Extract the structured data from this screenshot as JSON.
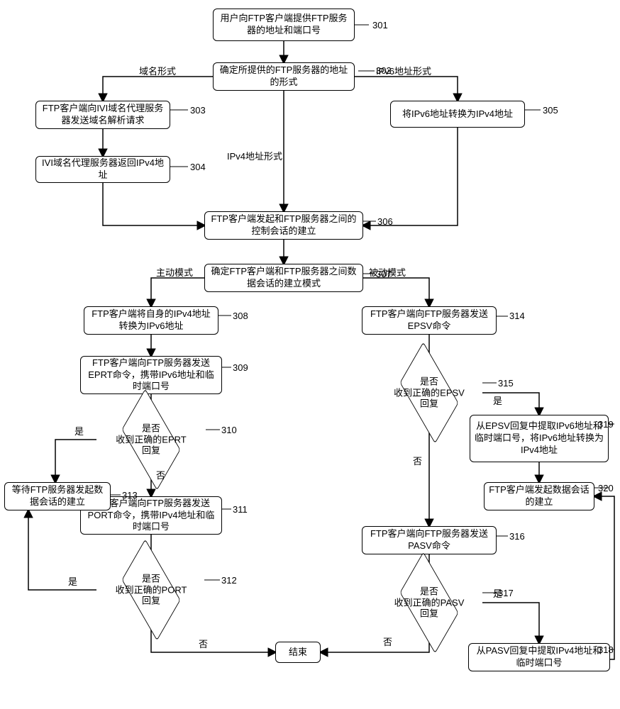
{
  "flowchart": {
    "n301": "用户向FTP客户端提供FTP服务器的地址和端口号",
    "n302": "确定所提供的FTP服务器的地址的形式",
    "n303": "FTP客户端向IVI域名代理服务器发送域名解析请求",
    "n304": "IVI域名代理服务器返回IPv4地址",
    "n305": "将IPv6地址转换为IPv4地址",
    "n306": "FTP客户端发起和FTP服务器之间的控制会话的建立",
    "n307": "确定FTP客户端和FTP服务器之间数据会话的建立模式",
    "n308": "FTP客户端将自身的IPv4地址转换为IPv6地址",
    "n309": "FTP客户端向FTP服务器发送EPRT命令，携带IPv6地址和临时端口号",
    "n310": "是否\n收到正确的EPRT\n回复",
    "n311": "FTP客户端向FTP服务器发送PORT命令，携带IPv4地址和临时端口号",
    "n312": "是否\n收到正确的PORT\n回复",
    "n313": "等待FTP服务器发起数据会话的建立",
    "n314": "FTP客户端向FTP服务器发送EPSV命令",
    "n315": "是否\n收到正确的EPSV\n回复",
    "n316": "FTP客户端向FTP服务器发送PASV命令",
    "n317": "是否\n收到正确的PASV\n回复",
    "n318": "从PASV回复中提取IPv4地址和临时端口号",
    "n319": "从EPSV回复中提取IPv6地址和临时端口号，将IPv6地址转换为IPv4地址",
    "n320": "FTP客户端发起数据会话的建立",
    "end": "结束"
  },
  "refs": {
    "r301": "301",
    "r302": "302",
    "r303": "303",
    "r304": "304",
    "r305": "305",
    "r306": "306",
    "r307": "307",
    "r308": "308",
    "r309": "309",
    "r310": "310",
    "r311": "311",
    "r312": "312",
    "r313": "313",
    "r314": "314",
    "r315": "315",
    "r316": "316",
    "r317": "317",
    "r318": "318",
    "r319": "319",
    "r320": "320"
  },
  "edges": {
    "domain_form": "域名形式",
    "ipv4_form": "IPv4地址形式",
    "ipv6_addr_form": "IPv6地址形式",
    "active": "主动模式",
    "passive": "被动模式",
    "yes": "是",
    "no": "否"
  }
}
